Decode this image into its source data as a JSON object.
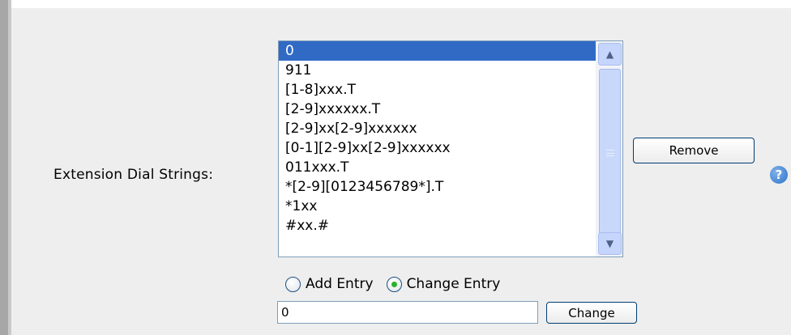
{
  "field": {
    "label": "Extension Dial Strings:"
  },
  "dial_strings": {
    "items": [
      "0",
      "911",
      "[1-8]xxx.T",
      "[2-9]xxxxxx.T",
      "[2-9]xx[2-9]xxxxxx",
      "[0-1][2-9]xx[2-9]xxxxxx",
      "011xxx.T",
      "*[2-9][0123456789*].T",
      "*1xx",
      "#xx.#"
    ],
    "selected_index": 0
  },
  "buttons": {
    "remove": "Remove",
    "change": "Change"
  },
  "radios": {
    "add_entry": "Add Entry",
    "change_entry": "Change Entry",
    "selected": "change_entry"
  },
  "entry": {
    "value": "0"
  },
  "icons": {
    "help": "help-icon",
    "scroll_up": "scroll-up-arrow-icon",
    "scroll_down": "scroll-down-arrow-icon"
  },
  "colors": {
    "selection": "#316ac5",
    "panel": "#eeeeee",
    "radio_dot": "#2bb02b"
  }
}
